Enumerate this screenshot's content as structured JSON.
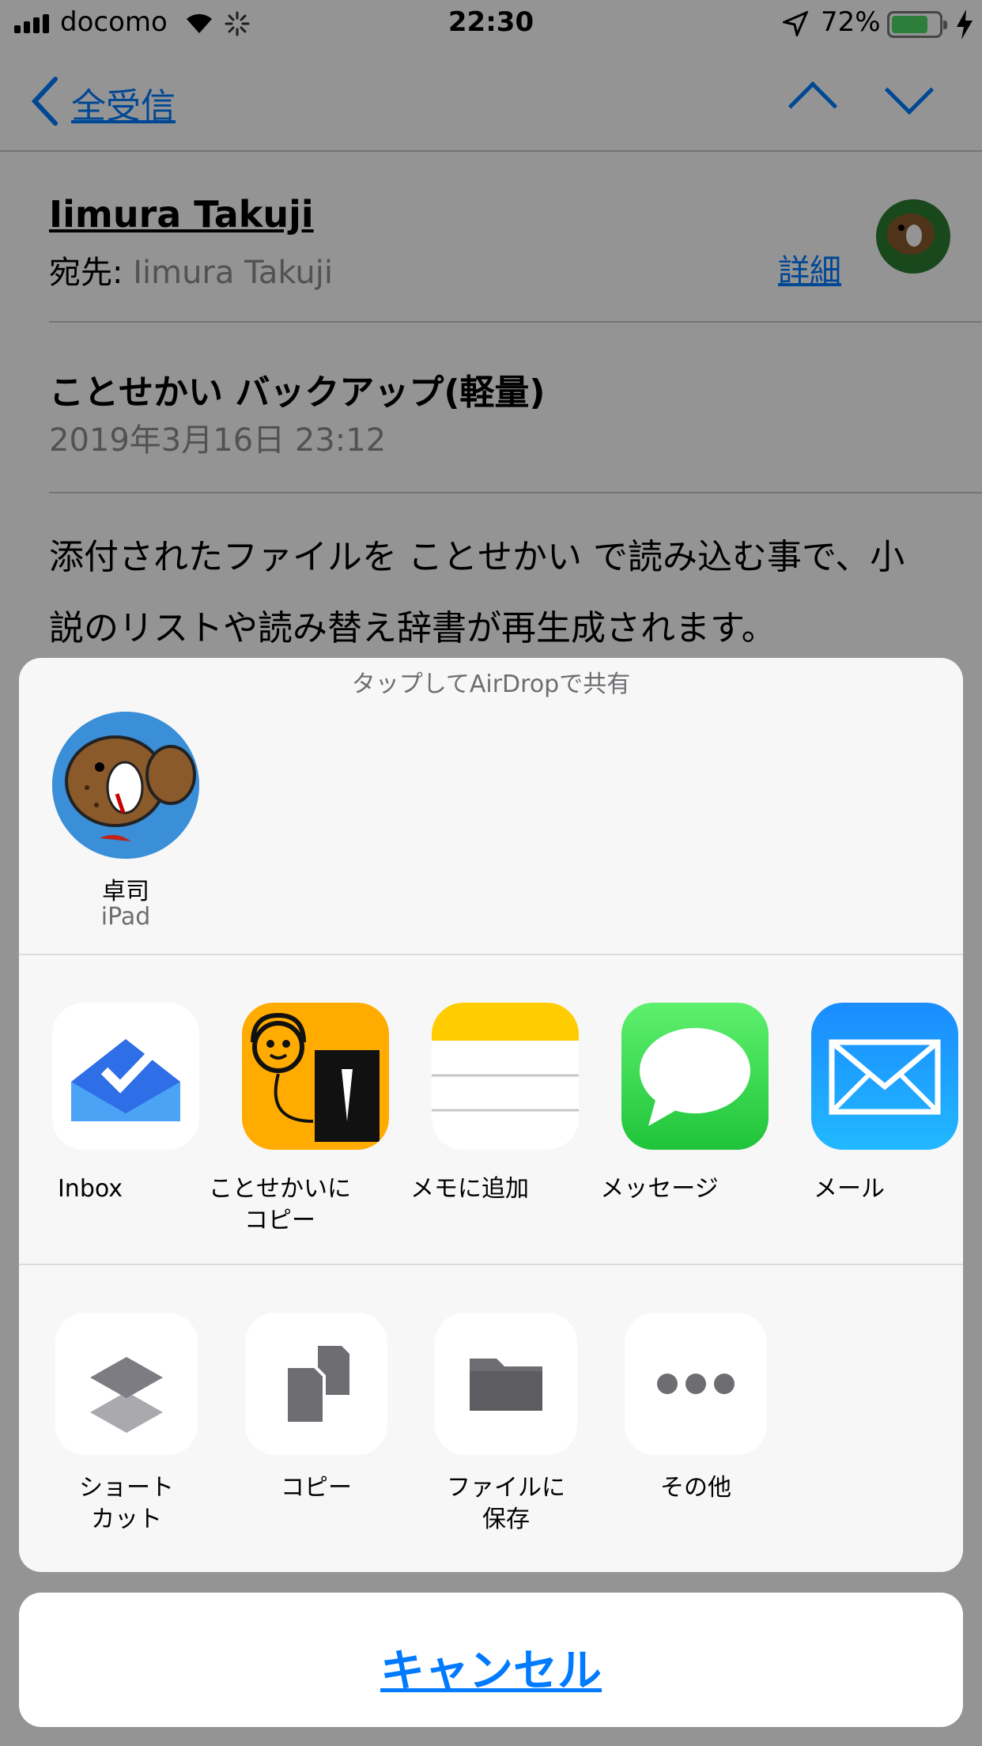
{
  "status_bar": {
    "carrier": "docomo",
    "time": "22:30",
    "battery_percent": "72%",
    "battery_level": 0.72,
    "battery_color": "#4cd964"
  },
  "nav": {
    "back_label": "全受信",
    "prev_icon": "chevron-up-icon",
    "next_icon": "chevron-down-icon"
  },
  "mail": {
    "from": "Iimura Takuji",
    "to_prefix": "宛先:",
    "to_name": "Iimura Takuji",
    "detail_link": "詳細",
    "subject": "ことせかい バックアップ(軽量)",
    "date": "2019年3月16日 23:12",
    "body": "添付されたファイルを ことせかい で読み込む事で、小説のリストや読み替え辞書が再生成されます。"
  },
  "share_sheet": {
    "airdrop_hint": "タップしてAirDropで共有",
    "airdrop_contact": {
      "name": "卓司",
      "device": "iPad"
    },
    "apps": [
      {
        "label": "Inbox",
        "icon": "inbox-app-icon"
      },
      {
        "label": "ことせかいに\nコピー",
        "icon": "kotosekai-app-icon"
      },
      {
        "label": "メモに追加",
        "icon": "notes-app-icon"
      },
      {
        "label": "メッセージ",
        "icon": "messages-app-icon"
      },
      {
        "label": "メール",
        "icon": "mail-app-icon"
      }
    ],
    "actions": [
      {
        "label": "ショート\nカット",
        "icon": "shortcuts-icon"
      },
      {
        "label": "コピー",
        "icon": "copy-icon"
      },
      {
        "label": "ファイルに\n保存",
        "icon": "folder-icon"
      },
      {
        "label": "その他",
        "icon": "more-icon"
      }
    ],
    "cancel_label": "キャンセル"
  },
  "colors": {
    "accent": "#007aff",
    "dim_overlay": "rgba(0,0,0,0.42)"
  }
}
